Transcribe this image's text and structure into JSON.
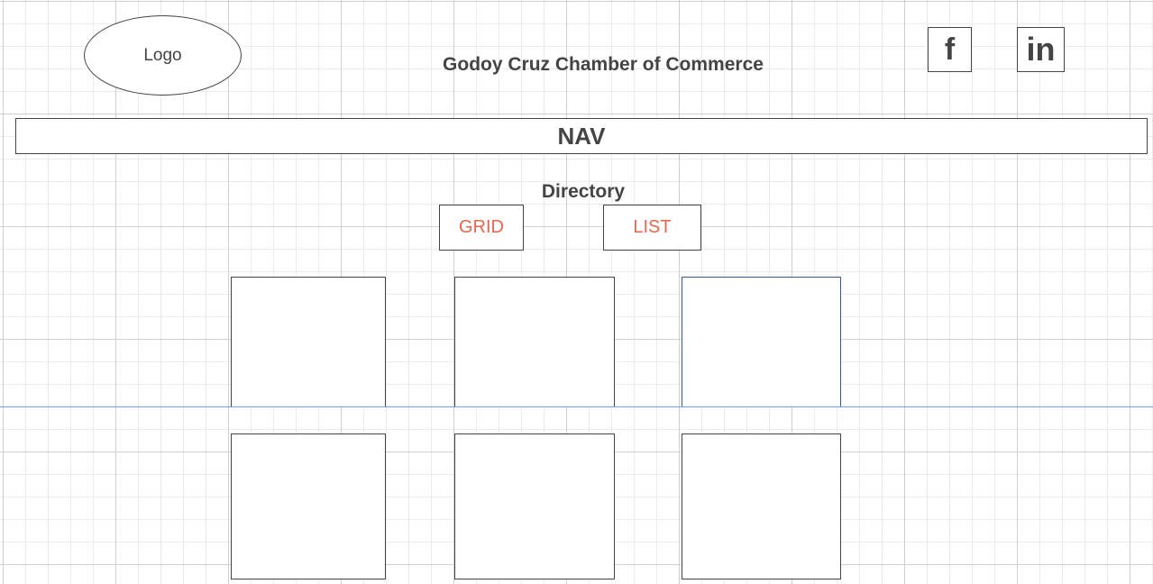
{
  "header": {
    "logo_label": "Logo",
    "title": "Godoy Cruz Chamber of Commerce",
    "social": {
      "facebook_label": "f",
      "linkedin_label": "in"
    }
  },
  "nav": {
    "label": "NAV"
  },
  "directory": {
    "title": "Directory",
    "grid_label": "GRID",
    "list_label": "LIST",
    "card_count_shown": 6
  },
  "colors": {
    "toggle_text": "#e8664e",
    "guide_line": "#7a9cf0",
    "selected_card_border": "#3a5a8c"
  }
}
